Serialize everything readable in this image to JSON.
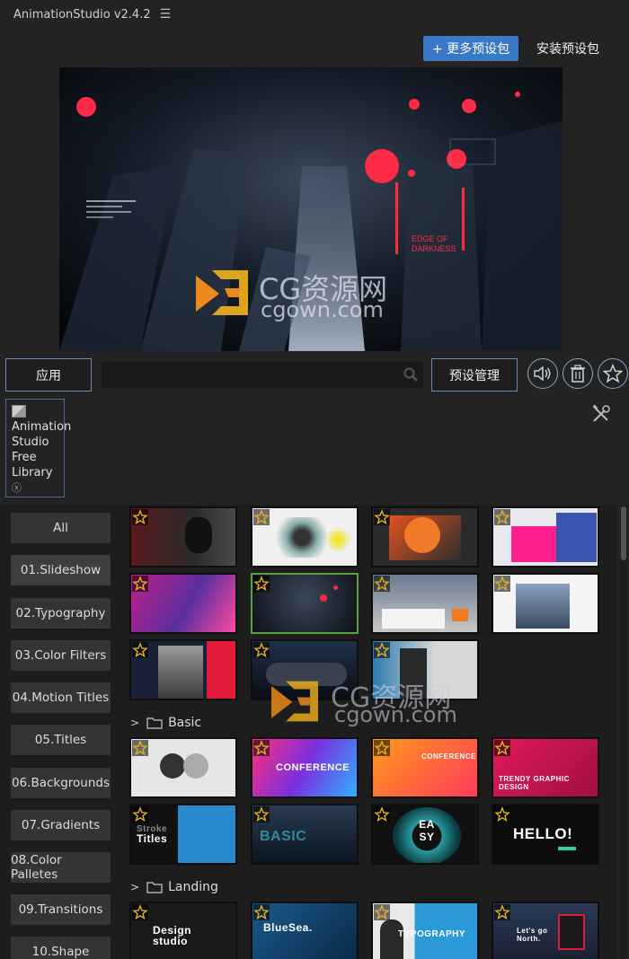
{
  "app": {
    "title": "AnimationStudio v2.4.2",
    "menu_icon": "hamburger-icon"
  },
  "header": {
    "more_presets": "+ 更多预设包",
    "install_presets": "安装预设包"
  },
  "preview": {
    "overlay_text_1": "EDGE OF",
    "overlay_text_2": "DARKNESS"
  },
  "toolbar": {
    "apply": "应用",
    "search_value": "",
    "manage": "预设管理",
    "sound_icon": "speaker-icon",
    "delete_icon": "trash-icon",
    "favorite_icon": "star-icon"
  },
  "library": {
    "line1": "Animation",
    "line2": "Studio",
    "line3": "Free",
    "line4": "Library",
    "close": "ⓧ"
  },
  "categories": [
    "All",
    "01.Slideshow",
    "02.Typography",
    "03.Color Filters",
    "04.Motion Titles",
    "05.Titles",
    "06.Backgrounds",
    "07.Gradients",
    "08.Color Palletes",
    "09.Transitions",
    "10.Shape"
  ],
  "groups": {
    "basic": "Basic",
    "landing": "Landing"
  },
  "thumb_labels": {
    "conference1": "CONFERENCE",
    "conference2": "CONFERENCE",
    "trendy": "TRENDY GRAPHIC DESIGN",
    "stroke_titles": "Titles",
    "stroke_top": "Stroke",
    "basic": "BASIC",
    "easy": "EA SY",
    "hello": "HELLO!",
    "design_studio": "Design studio",
    "bluesea": "BlueSea.",
    "typography": "TYPOGRAPHY",
    "letsgo": "Let's go North."
  },
  "watermark": {
    "brand": "CG资源网",
    "domain": "cgown.com"
  },
  "colors": {
    "accent": "#3a78c8",
    "selected": "#58a340",
    "panel": "#1d1d1d"
  }
}
